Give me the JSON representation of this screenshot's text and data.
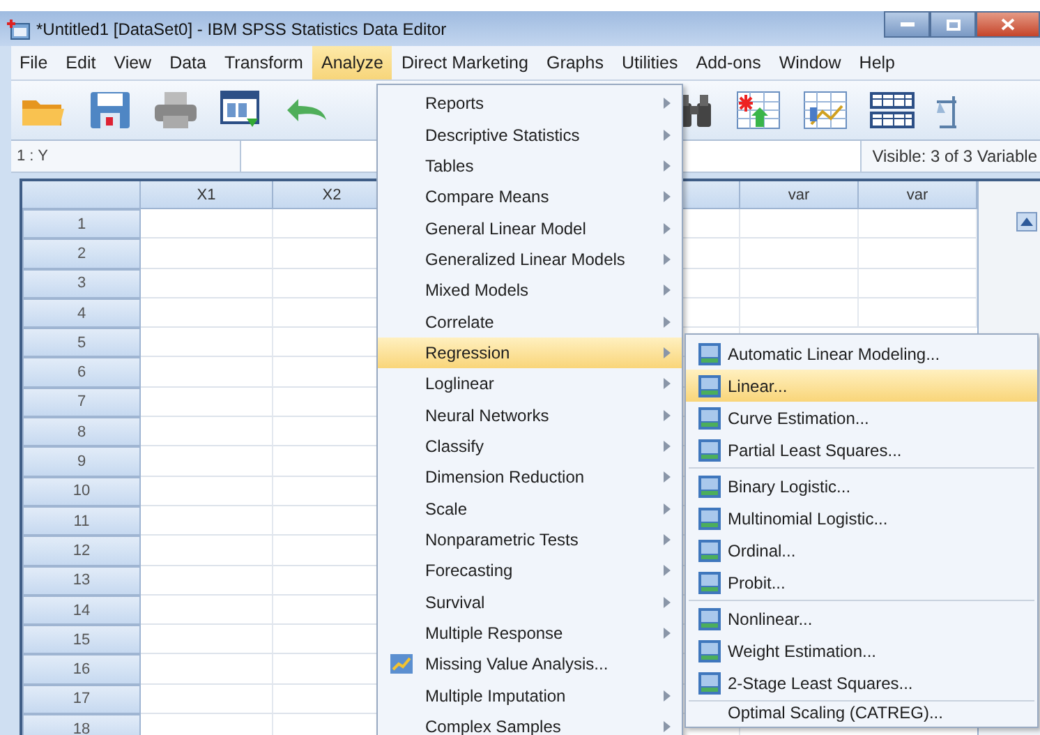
{
  "window": {
    "title": "*Untitled1 [DataSet0] - IBM SPSS Statistics Data Editor"
  },
  "menubar": [
    {
      "label": "File",
      "selected": false
    },
    {
      "label": "Edit",
      "selected": false
    },
    {
      "label": "View",
      "selected": false
    },
    {
      "label": "Data",
      "selected": false
    },
    {
      "label": "Transform",
      "selected": false
    },
    {
      "label": "Analyze",
      "selected": true
    },
    {
      "label": "Direct Marketing",
      "selected": false
    },
    {
      "label": "Graphs",
      "selected": false
    },
    {
      "label": "Utilities",
      "selected": false
    },
    {
      "label": "Add-ons",
      "selected": false
    },
    {
      "label": "Window",
      "selected": false
    },
    {
      "label": "Help",
      "selected": false
    }
  ],
  "cell_bar": {
    "cell": "1 : Y",
    "status": "Visible: 3 of 3 Variable"
  },
  "grid": {
    "columns": [
      "X1",
      "X2",
      "var",
      "var"
    ],
    "rows": [
      "1",
      "2",
      "3",
      "4",
      "5",
      "6",
      "7",
      "8",
      "9",
      "10",
      "11",
      "12",
      "13",
      "14",
      "15",
      "16",
      "17",
      "18"
    ]
  },
  "analyze_menu": [
    {
      "label": "Reports",
      "kind": "submenu",
      "selected": false
    },
    {
      "label": "Descriptive Statistics",
      "kind": "submenu",
      "selected": false
    },
    {
      "label": "Tables",
      "kind": "submenu",
      "selected": false
    },
    {
      "label": "Compare Means",
      "kind": "submenu",
      "selected": false
    },
    {
      "label": "General Linear Model",
      "kind": "submenu",
      "selected": false
    },
    {
      "label": "Generalized Linear Models",
      "kind": "submenu",
      "selected": false
    },
    {
      "label": "Mixed Models",
      "kind": "submenu",
      "selected": false
    },
    {
      "label": "Correlate",
      "kind": "submenu",
      "selected": false
    },
    {
      "label": "Regression",
      "kind": "submenu",
      "selected": true
    },
    {
      "label": "Loglinear",
      "kind": "submenu",
      "selected": false
    },
    {
      "label": "Neural Networks",
      "kind": "submenu",
      "selected": false
    },
    {
      "label": "Classify",
      "kind": "submenu",
      "selected": false
    },
    {
      "label": "Dimension Reduction",
      "kind": "submenu",
      "selected": false
    },
    {
      "label": "Scale",
      "kind": "submenu",
      "selected": false
    },
    {
      "label": "Nonparametric Tests",
      "kind": "submenu",
      "selected": false
    },
    {
      "label": "Forecasting",
      "kind": "submenu",
      "selected": false
    },
    {
      "label": "Survival",
      "kind": "submenu",
      "selected": false
    },
    {
      "label": "Multiple Response",
      "kind": "submenu",
      "selected": false
    },
    {
      "label": "Missing Value Analysis...",
      "kind": "command",
      "selected": false
    },
    {
      "label": "Multiple Imputation",
      "kind": "submenu",
      "selected": false
    },
    {
      "label": "Complex Samples",
      "kind": "submenu",
      "selected": false
    }
  ],
  "regression_menu": [
    [
      {
        "label": "Automatic Linear Modeling...",
        "selected": false
      },
      {
        "label": "Linear...",
        "selected": true
      },
      {
        "label": "Curve Estimation...",
        "selected": false
      },
      {
        "label": "Partial Least Squares...",
        "selected": false
      }
    ],
    [
      {
        "label": "Binary Logistic...",
        "selected": false
      },
      {
        "label": "Multinomial Logistic...",
        "selected": false
      },
      {
        "label": "Ordinal...",
        "selected": false
      },
      {
        "label": "Probit...",
        "selected": false
      }
    ],
    [
      {
        "label": "Nonlinear...",
        "selected": false
      },
      {
        "label": "Weight Estimation...",
        "selected": false
      },
      {
        "label": "2-Stage Least Squares...",
        "selected": false
      }
    ],
    [
      {
        "label": "Optimal Scaling (CATREG)...",
        "selected": false
      }
    ]
  ]
}
